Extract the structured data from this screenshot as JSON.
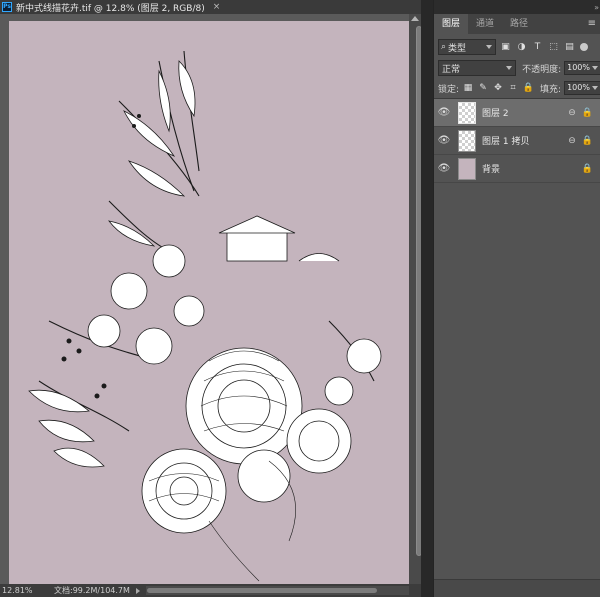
{
  "document": {
    "title": "新中式线描花卉.tif @ 12.8% (图层 2, RGB/8)",
    "app_badge": "Ps",
    "close_glyph": "×",
    "zoom": "12.81%",
    "doc_info": "文档:99.2M/104.7M",
    "canvas_color": "#c4b4bd"
  },
  "panel": {
    "tabs": [
      {
        "label": "图层",
        "active": true
      },
      {
        "label": "通道",
        "active": false
      },
      {
        "label": "路径",
        "active": false
      }
    ],
    "menu_glyph": "≡",
    "collapse_glyph": "»",
    "filter": {
      "label": "类型",
      "icon": "search-icon"
    },
    "filter_buttons": [
      {
        "icon": "image-filter-icon",
        "glyph": "▣"
      },
      {
        "icon": "adjustment-filter-icon",
        "glyph": "◑"
      },
      {
        "icon": "type-filter-icon",
        "glyph": "T"
      },
      {
        "icon": "shape-filter-icon",
        "glyph": "⬚"
      },
      {
        "icon": "smart-object-filter-icon",
        "glyph": "▤"
      }
    ],
    "blend_mode": "正常",
    "opacity_label": "不透明度:",
    "opacity_value": "100%",
    "lock_label": "锁定:",
    "lock_buttons": [
      {
        "icon": "lock-transparent-pixels-icon",
        "glyph": "▦"
      },
      {
        "icon": "lock-image-pixels-icon",
        "glyph": "✎"
      },
      {
        "icon": "lock-position-icon",
        "glyph": "✥"
      },
      {
        "icon": "lock-artboard-icon",
        "glyph": "⌗"
      },
      {
        "icon": "lock-all-icon",
        "glyph": "🔒"
      }
    ],
    "fill_label": "填充:",
    "fill_value": "100%",
    "layers": [
      {
        "name": "图层 2",
        "selected": true,
        "thumb": "transparent",
        "link": "⊖",
        "lock": "🔒"
      },
      {
        "name": "图层 1 拷贝",
        "selected": false,
        "thumb": "transparent",
        "link": "⊖",
        "lock": "🔒"
      },
      {
        "name": "背景",
        "selected": false,
        "thumb": "background",
        "link": "",
        "lock": "🔒"
      }
    ],
    "eye_glyph": "👁"
  }
}
